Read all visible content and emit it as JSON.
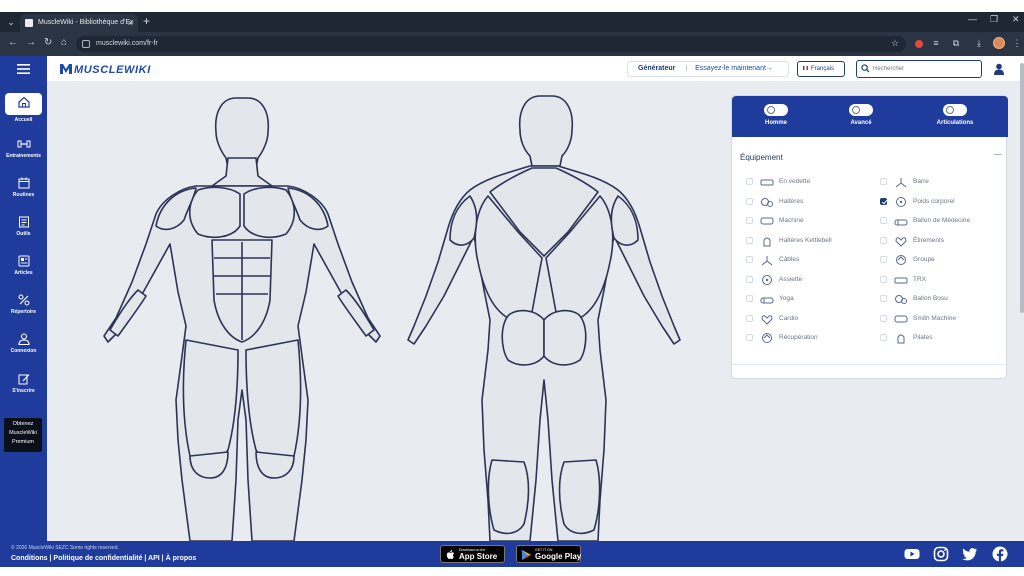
{
  "browser": {
    "tab_title": "MuscleWiki - Bibliothèque d'Ex",
    "url": "musclewiki.com/fr-fr"
  },
  "header": {
    "logo_text": "MUSCLEWIKI",
    "generator_label": "Générateur",
    "generator_separator": "|",
    "generator_cta": "Essayez-le maintenant→",
    "language": "Français",
    "search_placeholder": "Rechercher"
  },
  "sidebar": {
    "items": [
      {
        "label": "Accueil",
        "icon": "home-icon"
      },
      {
        "label": "Entrainements",
        "icon": "dumbbell-icon"
      },
      {
        "label": "Routines",
        "icon": "calendar-icon"
      },
      {
        "label": "Outils",
        "icon": "tools-icon"
      },
      {
        "label": "Articles",
        "icon": "article-icon"
      },
      {
        "label": "Répertoire",
        "icon": "directory-icon"
      },
      {
        "label": "Connexion",
        "icon": "login-icon"
      },
      {
        "label": "S'inscrire",
        "icon": "register-icon"
      }
    ],
    "premium_lines": [
      "Obtenez",
      "MuscleWiki",
      "Premium"
    ]
  },
  "panel": {
    "toggles": [
      {
        "label": "Homme",
        "on": false
      },
      {
        "label": "Avancé",
        "on": false
      },
      {
        "label": "Articulations",
        "on": false
      }
    ],
    "equipment_title": "Équipement",
    "equipment_left": [
      {
        "label": "En vedette",
        "checked": false
      },
      {
        "label": "Haltères",
        "checked": false
      },
      {
        "label": "Machine",
        "checked": false
      },
      {
        "label": "Haltères Kettlebell",
        "checked": false
      },
      {
        "label": "Câbles",
        "checked": false
      },
      {
        "label": "Assiette",
        "checked": false
      },
      {
        "label": "Yoga",
        "checked": false
      },
      {
        "label": "Cardio",
        "checked": false
      },
      {
        "label": "Récupération",
        "checked": false
      }
    ],
    "equipment_right": [
      {
        "label": "Barre",
        "checked": false
      },
      {
        "label": "Poids corporel",
        "checked": true
      },
      {
        "label": "Ballon de Médecine",
        "checked": false
      },
      {
        "label": "Étirements",
        "checked": false
      },
      {
        "label": "Groupe",
        "checked": false
      },
      {
        "label": "TRX",
        "checked": false
      },
      {
        "label": "Ballon Bosu",
        "checked": false
      },
      {
        "label": "Smith Machine",
        "checked": false
      },
      {
        "label": "Pilates",
        "checked": false
      }
    ]
  },
  "footer": {
    "copyright": "© 2026 MuscleWiki SEZC Some rights reserved.",
    "links": "Conditions | Politique de confidentialité | API | À propos",
    "app_store_small": "Download on the",
    "app_store_big": "App Store",
    "google_play_small": "GET IT ON",
    "google_play_big": "Google Play"
  },
  "colors": {
    "primary": "#1f3b9c",
    "background": "#e8ecf1",
    "body_fill": "#e3e6ea",
    "body_stroke": "#2c3456"
  }
}
